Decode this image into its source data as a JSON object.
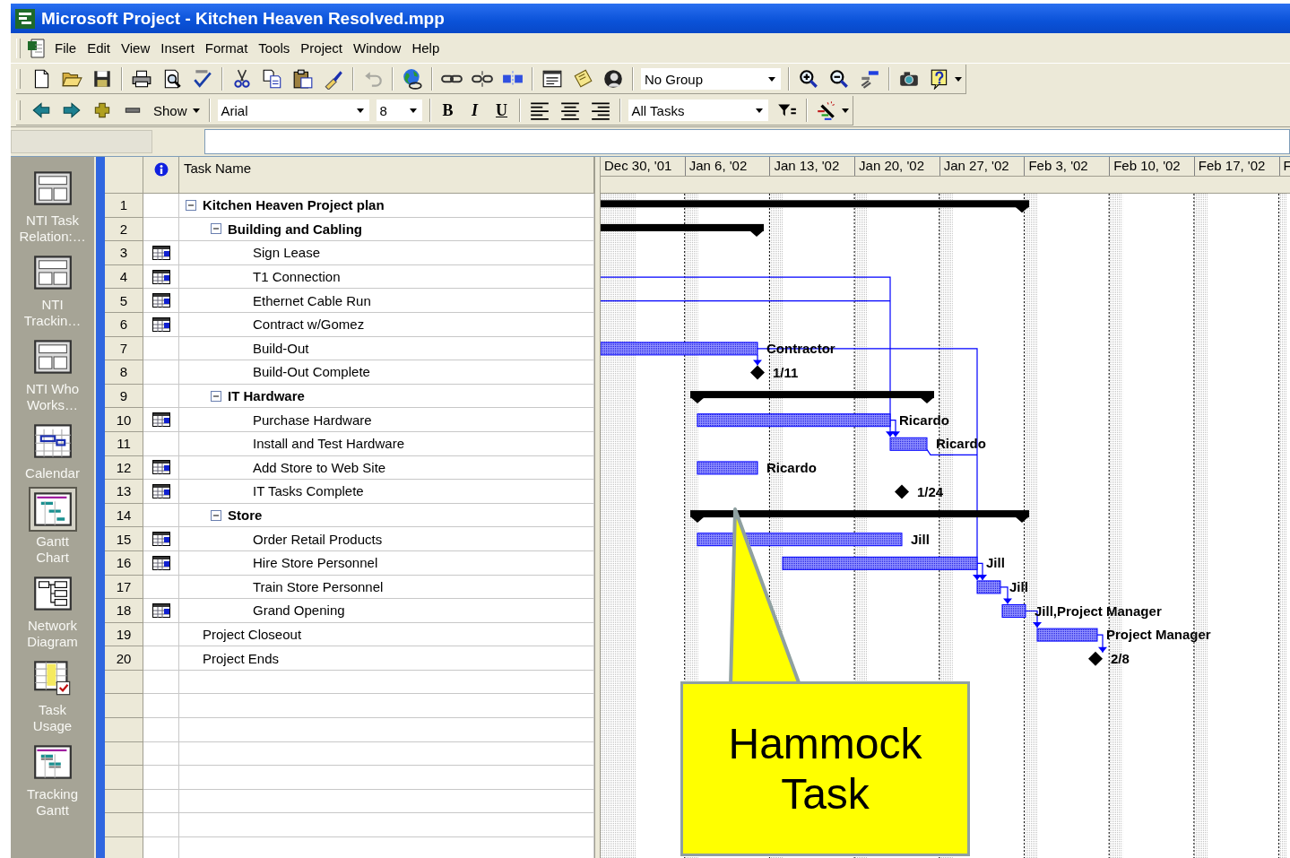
{
  "window": {
    "title": "Microsoft Project - Kitchen Heaven Resolved.mpp"
  },
  "menu": [
    "File",
    "Edit",
    "View",
    "Insert",
    "Format",
    "Tools",
    "Project",
    "Window",
    "Help"
  ],
  "toolbar": {
    "group": "No Group",
    "show": "Show",
    "font": "Arial",
    "font_size": "8",
    "format_buttons": [
      "B",
      "I",
      "U"
    ],
    "filter": "All Tasks"
  },
  "views": [
    {
      "label": "NTI Task Relation:…",
      "selected": false
    },
    {
      "label": "NTI Trackin…",
      "selected": false
    },
    {
      "label": "NTI Who Works…",
      "selected": false
    },
    {
      "label": "Calendar",
      "selected": false
    },
    {
      "label": "Gantt Chart",
      "selected": true
    },
    {
      "label": "Network Diagram",
      "selected": false
    },
    {
      "label": "Task Usage",
      "selected": false
    },
    {
      "label": "Tracking Gantt",
      "selected": false
    }
  ],
  "table": {
    "column": "Task Name"
  },
  "timescale": [
    "Dec 30, '01",
    "Jan 6, '02",
    "Jan 13, '02",
    "Jan 20, '02",
    "Jan 27, '02",
    "Feb 3, '02",
    "Feb 10, '02",
    "Feb 17, '02",
    "F"
  ],
  "tasks": [
    {
      "id": "1",
      "name": "Kitchen Heaven Project plan",
      "indicator": false,
      "expanded": true,
      "bar": {
        "kind": "summary"
      },
      "children": [
        {
          "id": "2",
          "name": "Building and Cabling",
          "indicator": false,
          "expanded": true,
          "bar": {
            "kind": "summary"
          },
          "children": [
            {
              "id": "3",
              "name": "Sign Lease",
              "indicator": true
            },
            {
              "id": "4",
              "name": "T1 Connection",
              "indicator": true
            },
            {
              "id": "5",
              "name": "Ethernet Cable Run",
              "indicator": true
            },
            {
              "id": "6",
              "name": "Contract w/Gomez",
              "indicator": true
            },
            {
              "id": "7",
              "name": "Build-Out",
              "indicator": false,
              "bar": {
                "kind": "task",
                "label": "Contractor"
              }
            },
            {
              "id": "8",
              "name": "Build-Out Complete",
              "indicator": false,
              "bar": {
                "kind": "milestone",
                "label": "1/11"
              }
            }
          ]
        },
        {
          "id": "9",
          "name": "IT Hardware",
          "indicator": false,
          "expanded": true,
          "bar": {
            "kind": "summary"
          },
          "children": [
            {
              "id": "10",
              "name": "Purchase Hardware",
              "indicator": true,
              "bar": {
                "kind": "task",
                "label": "Ricardo"
              }
            },
            {
              "id": "11",
              "name": "Install and Test Hardware",
              "indicator": false,
              "bar": {
                "kind": "task",
                "label": "Ricardo"
              }
            },
            {
              "id": "12",
              "name": "Add Store to Web Site",
              "indicator": true,
              "bar": {
                "kind": "task",
                "label": "Ricardo"
              }
            },
            {
              "id": "13",
              "name": "IT Tasks Complete",
              "indicator": true,
              "bar": {
                "kind": "milestone",
                "label": "1/24"
              }
            }
          ]
        },
        {
          "id": "14",
          "name": "Store",
          "indicator": false,
          "expanded": true,
          "bar": {
            "kind": "summary"
          },
          "children": [
            {
              "id": "15",
              "name": "Order Retail Products",
              "indicator": true,
              "bar": {
                "kind": "task",
                "label": "Jill"
              }
            },
            {
              "id": "16",
              "name": "Hire Store Personnel",
              "indicator": true,
              "bar": {
                "kind": "task",
                "label": "Jill"
              }
            },
            {
              "id": "17",
              "name": "Train Store Personnel",
              "indicator": false,
              "bar": {
                "kind": "task",
                "label": "Jill"
              }
            },
            {
              "id": "18",
              "name": "Grand Opening",
              "indicator": true,
              "bar": {
                "kind": "task",
                "label": "Jill,Project Manager"
              }
            }
          ]
        }
      ]
    },
    {
      "id": "19",
      "name": "Project Closeout",
      "indicator": false,
      "bar": {
        "kind": "task",
        "label": "Project Manager"
      }
    },
    {
      "id": "20",
      "name": "Project Ends",
      "indicator": false,
      "bar": {
        "kind": "milestone",
        "label": "2/8"
      }
    }
  ],
  "callout": {
    "text": "Hammock Task"
  }
}
